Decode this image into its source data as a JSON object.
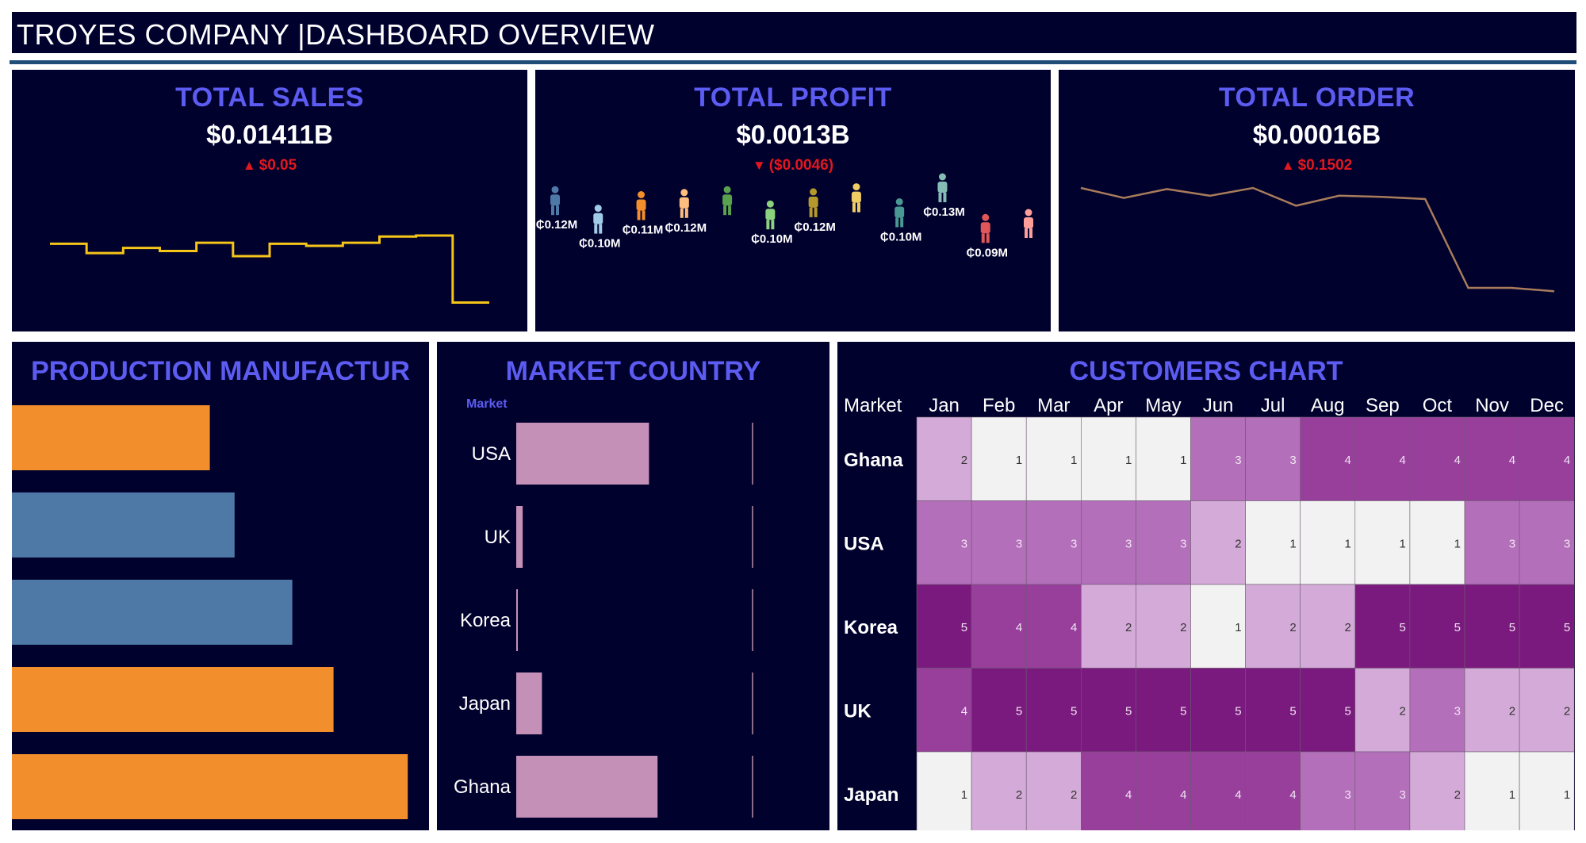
{
  "header": {
    "title": "TROYES COMPANY |DASHBOARD OVERVIEW"
  },
  "kpis": {
    "sales": {
      "title": "TOTAL SALES",
      "value": "$0.01411B",
      "delta_arrow": "▲",
      "delta": "$0.05"
    },
    "profit": {
      "title": "TOTAL PROFIT",
      "value": "$0.0013B",
      "delta_arrow": "▼",
      "delta": "($0.0046)"
    },
    "order": {
      "title": "TOTAL ORDER",
      "value": "$0.00016B",
      "delta_arrow": "▲",
      "delta": "$0.1502"
    }
  },
  "colors": {
    "panel_bg": "#01012e",
    "title_blue": "#5c5cf2",
    "accent_yellow": "#f5c518",
    "line_brown": "#a87c5a",
    "bar_orange": "#f28e2b",
    "bar_blue": "#4e79a7",
    "bar_pink": "#c490b8",
    "delta_red": "#e3171e"
  },
  "production": {
    "title": "PRODUCTION MANUFACTUR",
    "bar_values": [
      0.48,
      0.54,
      0.68,
      0.78,
      0.96
    ],
    "bar_colors": [
      "#f28e2b",
      "#4e79a7",
      "#4e79a7",
      "#f28e2b",
      "#f28e2b"
    ]
  },
  "market": {
    "title": "MARKET COUNTRY",
    "column_header": "Market",
    "rows": [
      {
        "label": "USA",
        "value": 0.62
      },
      {
        "label": "UK",
        "value": 0.03
      },
      {
        "label": "Korea",
        "value": 0.005
      },
      {
        "label": "Japan",
        "value": 0.12
      },
      {
        "label": "Ghana",
        "value": 0.66
      }
    ]
  },
  "customers": {
    "title": "CUSTOMERS CHART",
    "row_header": "Market",
    "months": [
      "Jan",
      "Feb",
      "Mar",
      "Apr",
      "May",
      "Jun",
      "Jul",
      "Aug",
      "Sep",
      "Oct",
      "Nov",
      "Dec"
    ],
    "rows": [
      {
        "label": "Ghana",
        "values": [
          2,
          1,
          1,
          1,
          1,
          3,
          3,
          4,
          4,
          4,
          4,
          4
        ]
      },
      {
        "label": "USA",
        "values": [
          3,
          3,
          3,
          3,
          3,
          2,
          1,
          1,
          1,
          1,
          3,
          3
        ]
      },
      {
        "label": "Korea",
        "values": [
          5,
          4,
          4,
          2,
          2,
          1,
          2,
          2,
          5,
          5,
          5,
          5
        ]
      },
      {
        "label": "UK",
        "values": [
          4,
          5,
          5,
          5,
          5,
          5,
          5,
          5,
          2,
          3,
          2,
          2
        ]
      },
      {
        "label": "Japan",
        "values": [
          1,
          2,
          2,
          4,
          4,
          4,
          4,
          3,
          3,
          2,
          1,
          1
        ]
      }
    ],
    "scale_colors": {
      "1": "#f2f2f2",
      "2": "#d4abd8",
      "3": "#b46fba",
      "4": "#983f9c",
      "5": "#7b1a7e"
    }
  },
  "chart_data": [
    {
      "type": "line",
      "title": "TOTAL SALES",
      "x": [
        1,
        2,
        3,
        4,
        5,
        6,
        7,
        8,
        9,
        10,
        11,
        12
      ],
      "values": [
        0.62,
        0.53,
        0.58,
        0.55,
        0.63,
        0.5,
        0.62,
        0.6,
        0.63,
        0.69,
        0.7,
        0.05
      ],
      "ylim": [
        0,
        1
      ]
    },
    {
      "type": "scatter",
      "title": "TOTAL PROFIT",
      "points": [
        {
          "label": "₵0.12M",
          "color": "#4e79a7",
          "y": 0.82
        },
        {
          "label": "₵0.10M",
          "color": "#a0cbe8",
          "y": 0.56
        },
        {
          "label": "₵0.11M",
          "color": "#f28e2b",
          "y": 0.75
        },
        {
          "label": "₵0.12M",
          "color": "#ffbe7d",
          "y": 0.78
        },
        {
          "label": "",
          "color": "#59a14f",
          "y": 0.82
        },
        {
          "label": "₵0.10M",
          "color": "#8cd17d",
          "y": 0.62
        },
        {
          "label": "₵0.12M",
          "color": "#b6992d",
          "y": 0.79
        },
        {
          "label": "",
          "color": "#f1ce63",
          "y": 0.86
        },
        {
          "label": "₵0.10M",
          "color": "#499894",
          "y": 0.65
        },
        {
          "label": "₵0.13M",
          "color": "#86bcb6",
          "y": 1.0
        },
        {
          "label": "₵0.09M",
          "color": "#e15759",
          "y": 0.43
        },
        {
          "label": "",
          "color": "#ff9d9a",
          "y": 0.5
        }
      ]
    },
    {
      "type": "line",
      "title": "TOTAL ORDER",
      "x": [
        1,
        2,
        3,
        4,
        5,
        6,
        7,
        8,
        9,
        10,
        11,
        12
      ],
      "values": [
        0.95,
        0.86,
        0.94,
        0.88,
        0.95,
        0.79,
        0.88,
        0.87,
        0.85,
        0.05,
        0.05,
        0.02
      ],
      "ylim": [
        0,
        1
      ]
    },
    {
      "type": "bar",
      "title": "PRODUCTION MANUFACTUR",
      "values": [
        0.48,
        0.54,
        0.68,
        0.78,
        0.96
      ]
    },
    {
      "type": "bar",
      "title": "MARKET COUNTRY",
      "categories": [
        "USA",
        "UK",
        "Korea",
        "Japan",
        "Ghana"
      ],
      "values": [
        0.62,
        0.03,
        0.005,
        0.12,
        0.66
      ]
    },
    {
      "type": "heatmap",
      "title": "CUSTOMERS CHART",
      "x": [
        "Jan",
        "Feb",
        "Mar",
        "Apr",
        "May",
        "Jun",
        "Jul",
        "Aug",
        "Sep",
        "Oct",
        "Nov",
        "Dec"
      ],
      "y": [
        "Ghana",
        "USA",
        "Korea",
        "UK",
        "Japan"
      ],
      "values": [
        [
          2,
          1,
          1,
          1,
          1,
          3,
          3,
          4,
          4,
          4,
          4,
          4
        ],
        [
          3,
          3,
          3,
          3,
          3,
          2,
          1,
          1,
          1,
          1,
          3,
          3
        ],
        [
          5,
          4,
          4,
          2,
          2,
          1,
          2,
          2,
          5,
          5,
          5,
          5
        ],
        [
          4,
          5,
          5,
          5,
          5,
          5,
          5,
          5,
          2,
          3,
          2,
          2
        ],
        [
          1,
          2,
          2,
          4,
          4,
          4,
          4,
          3,
          3,
          2,
          1,
          1
        ]
      ]
    }
  ]
}
